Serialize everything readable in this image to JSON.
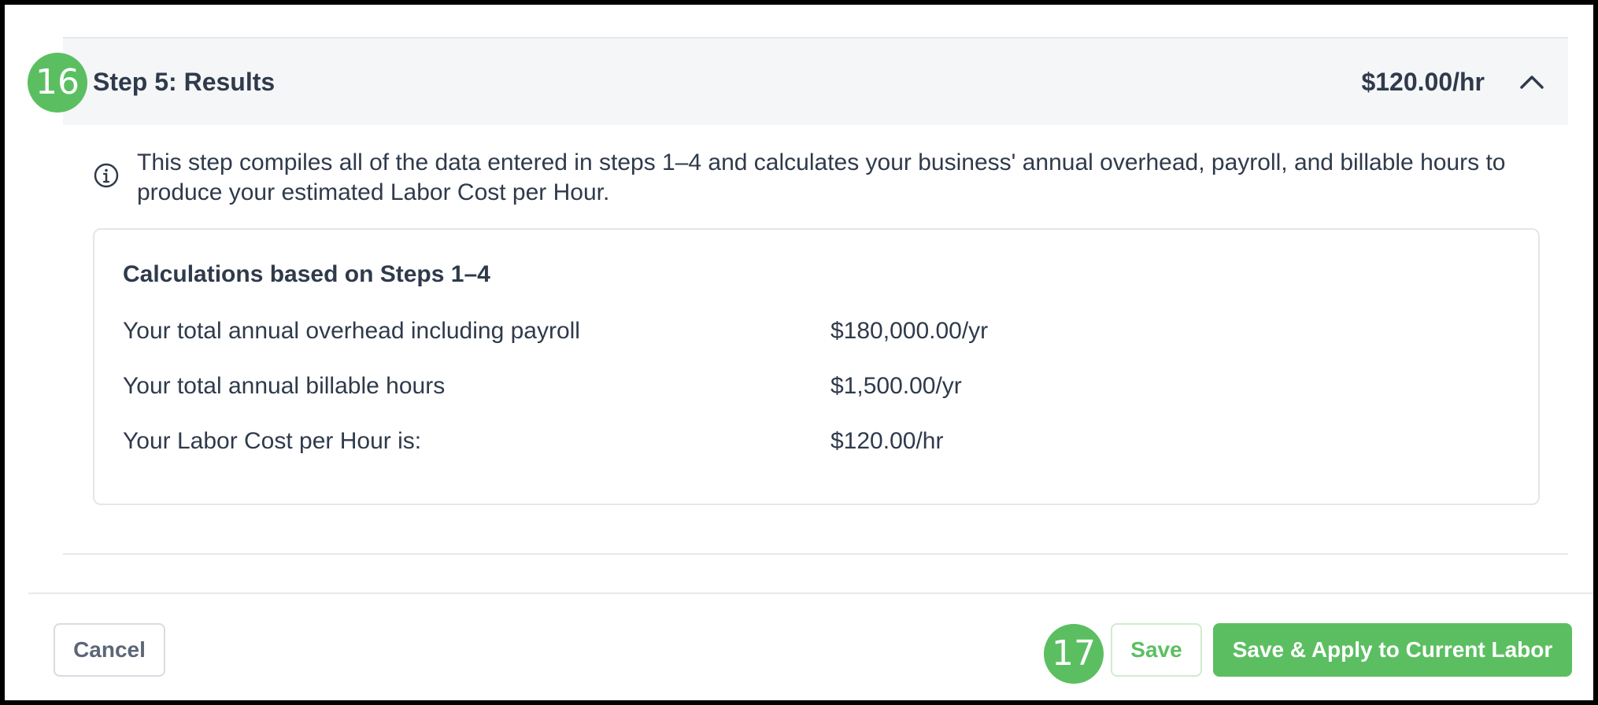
{
  "step": {
    "title": "Step 5: Results",
    "header_rate": "$120.00/hr",
    "info_text": "This step compiles all of the data entered in steps 1–4 and calculates your business' annual overhead, payroll, and billable hours to produce your estimated Labor Cost per Hour."
  },
  "calculations": {
    "title": "Calculations based on Steps 1–4",
    "rows": [
      {
        "label": "Your total annual overhead including payroll",
        "value": "$180,000.00/yr"
      },
      {
        "label": "Your total annual billable hours",
        "value": "$1,500.00/yr"
      },
      {
        "label": "Your Labor Cost per Hour is:",
        "value": "$120.00/hr"
      }
    ]
  },
  "footer": {
    "cancel_label": "Cancel",
    "save_label": "Save",
    "apply_label": "Save & Apply to Current Labor"
  },
  "badges": {
    "b16": "16",
    "b17": "17"
  },
  "colors": {
    "accent_green": "#5bbf62",
    "text_dark": "#2f3a4b",
    "header_bg": "#f5f6f8"
  },
  "icons": {
    "collapse": "chevron-up-icon",
    "info": "info-circle-icon"
  }
}
